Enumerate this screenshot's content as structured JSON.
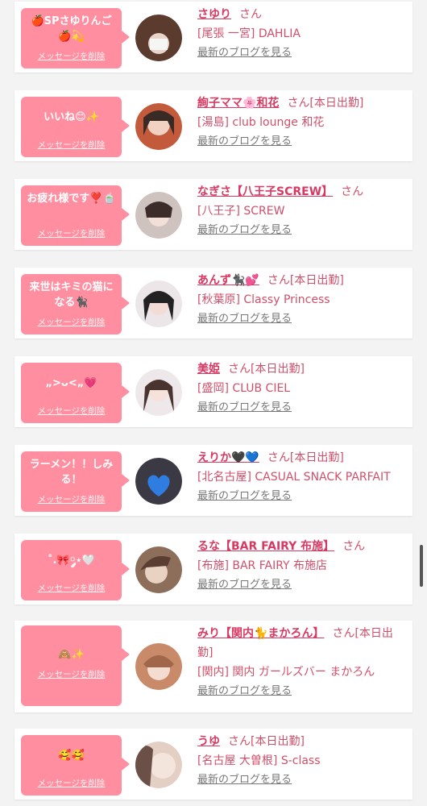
{
  "items": [
    {
      "bubble_text": "🍎SPさゆりんご🍎💫",
      "delete_label": "メッセージを削除",
      "name": "さゆり",
      "san": "さん",
      "shop": "[尾張 一宮] DAHLIA",
      "blog": "最新のブログを見る",
      "avatar_color": "#5b3b2d"
    },
    {
      "bubble_text": "いいね😊✨",
      "delete_label": "メッセージを削除",
      "name": "絢子ママ🌸和花",
      "san": "さん[本日出勤]",
      "shop": "[湯島] club lounge 和花",
      "blog": "最新のブログを見る",
      "avatar_color": "#c45a3c"
    },
    {
      "bubble_text": "お疲れ様です❣️🍵",
      "delete_label": "メッセージを削除",
      "name": "なぎさ【八王子SCREW】",
      "san": "さん",
      "shop": "[八王子] SCREW",
      "blog": "最新のブログを見る",
      "avatar_color": "#b5a6a0"
    },
    {
      "bubble_text": "来世はキミの猫になる🐈‍⬛",
      "delete_label": "メッセージを削除",
      "name": "あんず🐈‍⬛💕",
      "san": "さん[本日出勤]",
      "shop": "[秋葉原] Classy Princess",
      "blog": "最新のブログを見る",
      "avatar_color": "#2d2a2d"
    },
    {
      "bubble_text": "„>ᴗ<„💗",
      "delete_label": "メッセージを削除",
      "name": "美姫",
      "san": "さん[本日出勤]",
      "shop": "[盛岡] CLUB CIEL",
      "blog": "最新のブログを見る",
      "avatar_color": "#d9c2c3"
    },
    {
      "bubble_text": "ラーメン！！しみる！",
      "delete_label": "メッセージを削除",
      "name": "えりか🖤💙",
      "san": "さん[本日出勤]",
      "shop": "[北名古屋] CASUAL SNACK PARFAIT",
      "blog": "最新のブログを見る",
      "avatar_color": "#3b3a44"
    },
    {
      "bubble_text": "˚.🎀༘⋆🤍",
      "delete_label": "メッセージを削除",
      "name": "るな【BAR FAIRY 布施】",
      "san": "さん",
      "shop": "[布施] BAR FAIRY 布施店",
      "blog": "最新のブログを見る",
      "avatar_color": "#8c6e5b"
    },
    {
      "bubble_text": "🙈✨",
      "delete_label": "メッセージを削除",
      "name": "みり【関内🐈まかろん】",
      "san": "さん[本日出勤]",
      "shop": "[関内] 関内 ガールズバー まかろん",
      "blog": "最新のブログを見る",
      "avatar_color": "#c98a6a"
    },
    {
      "bubble_text": "🥰🥰",
      "delete_label": "メッセージを削除",
      "name": "うゆ",
      "san": "さん[本日出勤]",
      "shop": "[名古屋 大曽根] S-class",
      "blog": "最新のブログを見る",
      "avatar_color": "#e3cfc4"
    }
  ]
}
